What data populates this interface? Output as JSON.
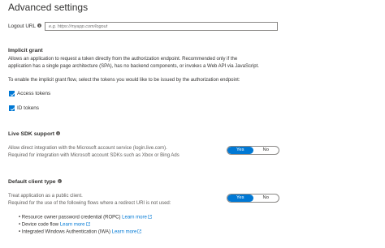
{
  "title": "Advanced settings",
  "logout": {
    "label": "Logout URL",
    "placeholder": "e.g. https://myapp.com/logout",
    "value": ""
  },
  "implicit": {
    "heading": "Implicit grant",
    "desc1": "Allows an application to request a token directly from the authorization endpoint. Recommended only if the",
    "desc2": "application has a single page architecture (SPA), has no backend components, or invokes a Web API via JavaScript.",
    "instruction": "To enable the implicit grant flow, select the tokens you would like to be issued by the authorization endpoint:",
    "access_tokens": "Access tokens",
    "id_tokens": "ID tokens",
    "access_checked": true,
    "id_checked": true
  },
  "live_sdk": {
    "heading": "Live SDK support",
    "desc1": "Allow direct integration with the Microsoft account service (login.live.com).",
    "desc2": "Required for integration with Microsoft account SDKs such as Xbox or Bing Ads",
    "yes": "Yes",
    "no": "No",
    "selected": "Yes"
  },
  "client_type": {
    "heading": "Default client type",
    "desc1": "Treat application as a public client.",
    "desc2": "Required for the use of the following flows where a redirect URI is not used:",
    "yes": "Yes",
    "no": "No",
    "selected": "Yes",
    "flows": [
      {
        "text": "Resource owner password credential (ROPC)",
        "link": "Learn more"
      },
      {
        "text": "Device code flow",
        "link": "Learn more"
      },
      {
        "text": "Integrated Windows Authentication (IWA)",
        "link": "Learn more"
      }
    ]
  },
  "colors": {
    "accent": "#0078d4",
    "text": "#323130",
    "muted": "#605e5c"
  },
  "icons": {
    "info": "info-icon",
    "external": "external-link-icon",
    "check": "checkmark-icon"
  }
}
